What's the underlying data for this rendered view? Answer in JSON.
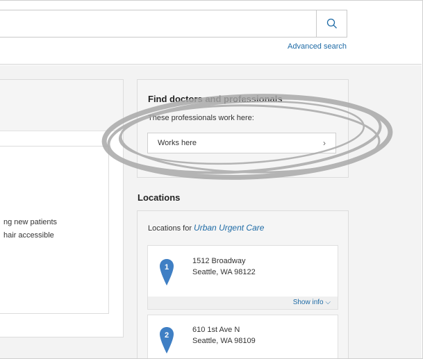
{
  "search": {
    "placeholder": "",
    "advanced_link": "Advanced search",
    "button_icon": "search-icon"
  },
  "left_panel": {
    "lines": [
      "ng new patients",
      "hair accessible"
    ]
  },
  "find_card": {
    "title": "Find doctors and professionals",
    "subtitle": "These professionals work here:",
    "button_label": "Works here",
    "button_icon": "chevron-right-icon"
  },
  "locations": {
    "heading": "Locations",
    "for_prefix": "Locations for",
    "place_name": "Urban Urgent Care",
    "items": [
      {
        "number": "1",
        "line1": "1512 Broadway",
        "line2": "Seattle, WA 98122",
        "show_info": "Show info"
      },
      {
        "number": "2",
        "line1": "610 1st Ave N",
        "line2": "Seattle, WA 98109"
      }
    ]
  },
  "colors": {
    "link": "#1d6aa5",
    "pin": "#3f7fc4",
    "panel_bg": "#f3f3f3"
  }
}
